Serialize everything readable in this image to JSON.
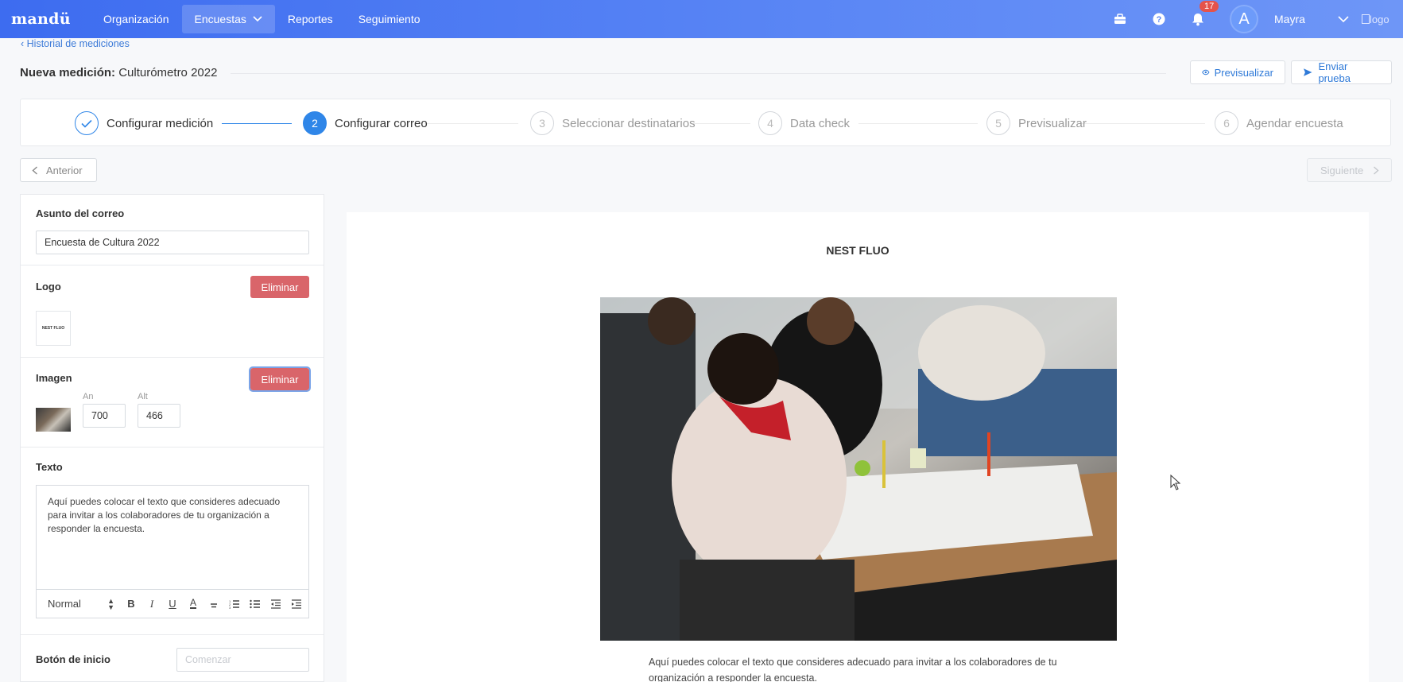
{
  "nav": {
    "brand": "mandü",
    "items": [
      {
        "label": "Organización"
      },
      {
        "label": "Encuestas"
      },
      {
        "label": "Reportes"
      },
      {
        "label": "Seguimiento"
      }
    ],
    "notification_count": "17",
    "avatar_initial": "A",
    "user_name": "Mayra",
    "logo_alt": "logo"
  },
  "header": {
    "breadcrumb": "Historial de mediciones",
    "title_prefix": "Nueva medición:",
    "title_name": "Culturómetro 2022",
    "preview_button": "Previsualizar",
    "send_test_button": "Enviar prueba"
  },
  "stepper": {
    "steps": [
      {
        "number": "1",
        "label": "Configurar medición",
        "state": "done"
      },
      {
        "number": "2",
        "label": "Configurar correo",
        "state": "active"
      },
      {
        "number": "3",
        "label": "Seleccionar destinatarios",
        "state": "pending"
      },
      {
        "number": "4",
        "label": "Data check",
        "state": "pending"
      },
      {
        "number": "5",
        "label": "Previsualizar",
        "state": "pending"
      },
      {
        "number": "6",
        "label": "Agendar encuesta",
        "state": "pending"
      }
    ]
  },
  "pager": {
    "prev": "Anterior",
    "next": "Siguiente"
  },
  "form": {
    "subject_label": "Asunto del correo",
    "subject_value": "Encuesta de Cultura 2022",
    "logo_label": "Logo",
    "logo_delete": "Eliminar",
    "logo_thumb_text": "NEST FLUO",
    "image_label": "Imagen",
    "image_delete": "Eliminar",
    "width_label": "An",
    "width_value": "700",
    "height_label": "Alt",
    "height_value": "466",
    "text_label": "Texto",
    "text_value": "Aquí puedes colocar el texto que consideres adecuado para invitar a los colaboradores de tu organización a responder la encuesta.",
    "toolbar_format": "Normal",
    "start_button_label": "Botón de inicio",
    "start_button_placeholder": "Comenzar"
  },
  "preview": {
    "company": "NEST FLUO",
    "body_text": "Aquí puedes colocar el texto que consideres adecuado para invitar a los colaboradores de tu organización a responder la encuesta."
  },
  "colors": {
    "nav_start": "#3d6cf0",
    "accent": "#2f86e8",
    "danger": "#d9656a",
    "badge": "#e5534b"
  }
}
